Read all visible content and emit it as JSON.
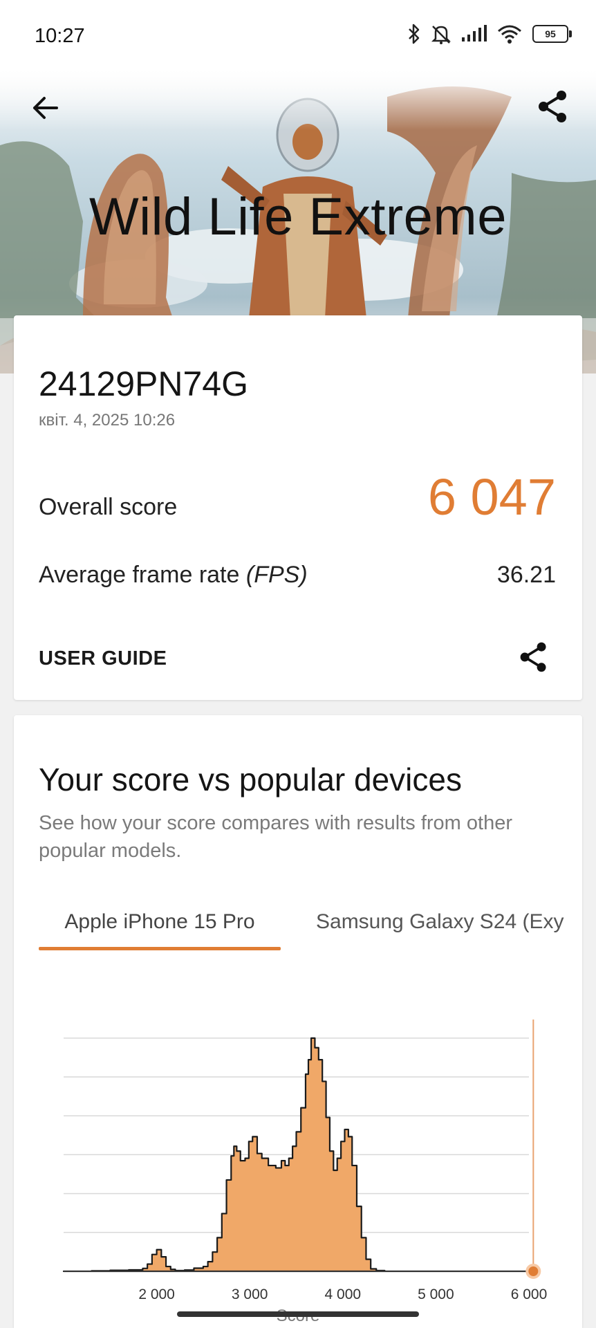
{
  "status_bar": {
    "time": "10:27",
    "battery": "95",
    "icons": [
      "bluetooth-icon",
      "mute-icon",
      "signal-icon",
      "wifi-icon",
      "battery-icon"
    ]
  },
  "hero": {
    "title": "Wild Life Extreme"
  },
  "result": {
    "device": "24129PN74G",
    "date": "квіт. 4, 2025 10:26",
    "overall_label": "Overall score",
    "overall_value": "6 047",
    "fps_label": "Average frame rate",
    "fps_unit": "(FPS)",
    "fps_value": "36.21",
    "user_guide": "USER GUIDE"
  },
  "compare": {
    "title": "Your score vs popular devices",
    "subtitle": "See how your score compares with results from other popular models.",
    "tabs": [
      {
        "label": "Apple iPhone 15 Pro",
        "selected": true
      },
      {
        "label": "Samsung Galaxy S24 (Exy"
      }
    ]
  },
  "colors": {
    "accent": "#e07d34",
    "histogram_fill": "#f0a868",
    "histogram_stroke": "#1a1a1a"
  },
  "chart_data": {
    "type": "area",
    "xlabel": "Score",
    "xlim": [
      1000,
      6000
    ],
    "x_ticks": [
      2000,
      3000,
      4000,
      5000,
      6000
    ],
    "x_tick_labels": [
      "2 000",
      "3 000",
      "4 000",
      "5 000",
      "6 000"
    ],
    "grid": true,
    "your_score": 6047,
    "series": [
      {
        "x": [
          1000,
          1300,
          1500,
          1700,
          1850,
          1900,
          1950,
          2000,
          2050,
          2100,
          2150,
          2200,
          2300,
          2400,
          2500,
          2550,
          2600,
          2650,
          2700,
          2750,
          2800,
          2830,
          2860,
          2900,
          2950,
          2990,
          3030,
          3080,
          3130,
          3200,
          3280,
          3340,
          3380,
          3420,
          3460,
          3500,
          3550,
          3600,
          3630,
          3660,
          3700,
          3740,
          3780,
          3820,
          3860,
          3900,
          3940,
          3980,
          4020,
          4060,
          4100,
          4150,
          4200,
          4250,
          4300,
          4360,
          4450,
          4600,
          6000
        ],
        "values": [
          0,
          0.2,
          0.4,
          0.6,
          1.2,
          3,
          7,
          9,
          6,
          2,
          0.8,
          0.3,
          0.5,
          1.3,
          2,
          4,
          8,
          14,
          24,
          38,
          48,
          52,
          50,
          46,
          47,
          54,
          56,
          49,
          47,
          44,
          43,
          46,
          44,
          47,
          52,
          58,
          68,
          82,
          88,
          97,
          93,
          88,
          79,
          64,
          50,
          42,
          47,
          54,
          59,
          56,
          44,
          27,
          14,
          5,
          1,
          0.3,
          0,
          0,
          0
        ]
      }
    ]
  }
}
